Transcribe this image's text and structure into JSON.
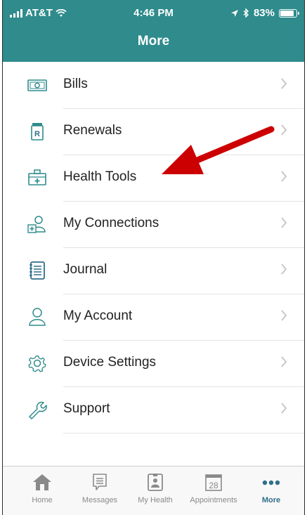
{
  "status_bar": {
    "carrier": "AT&T",
    "time": "4:46 PM",
    "battery": "83%"
  },
  "header": {
    "title": "More"
  },
  "menu": {
    "items": [
      {
        "label": "Bills",
        "icon": "bills-icon"
      },
      {
        "label": "Renewals",
        "icon": "prescription-icon"
      },
      {
        "label": "Health Tools",
        "icon": "medical-kit-icon"
      },
      {
        "label": "My Connections",
        "icon": "connections-icon"
      },
      {
        "label": "Journal",
        "icon": "journal-icon"
      },
      {
        "label": "My Account",
        "icon": "person-icon"
      },
      {
        "label": "Device Settings",
        "icon": "gear-icon"
      },
      {
        "label": "Support",
        "icon": "wrench-icon"
      }
    ]
  },
  "annotation": {
    "arrow_color": "#cc0000"
  },
  "colors": {
    "header": "#2f8b8c",
    "active_tab": "#2f6f8a"
  },
  "tabbar": {
    "tabs": [
      {
        "label": "Home",
        "icon": "home-icon"
      },
      {
        "label": "Messages",
        "icon": "messages-icon"
      },
      {
        "label": "My Health",
        "icon": "my-health-icon"
      },
      {
        "label": "Appointments",
        "icon": "calendar-icon",
        "day": "28"
      },
      {
        "label": "More",
        "icon": "more-dots-icon",
        "active": true
      }
    ]
  }
}
